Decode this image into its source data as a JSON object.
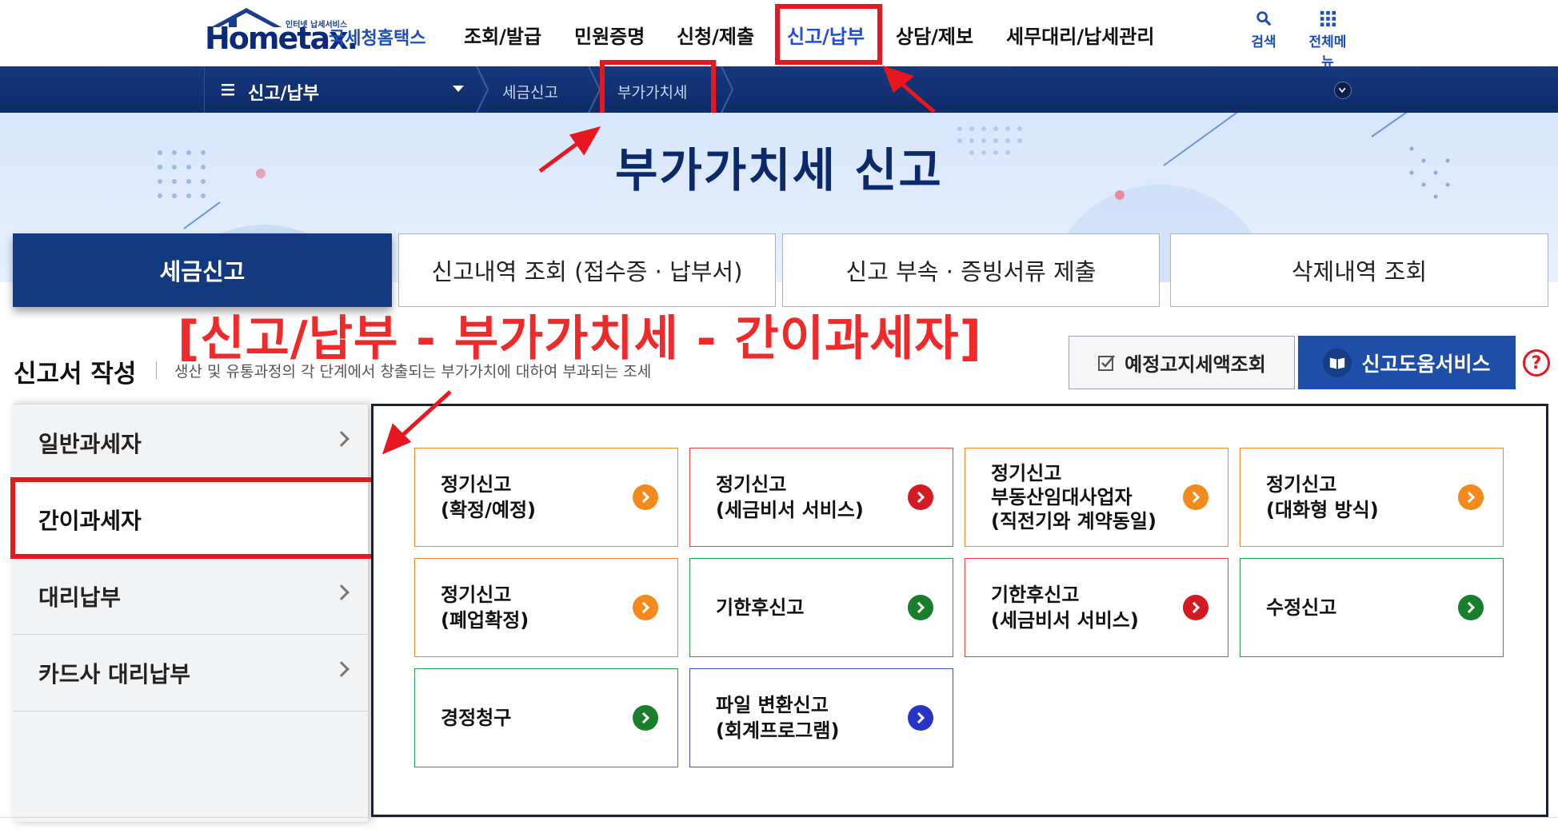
{
  "header": {
    "logo_sub": "인터넷 납세서비스",
    "logo_main": "Hometax.",
    "logo_kr": "국세청홈택스",
    "nav": [
      "조회/발급",
      "민원증명",
      "신청/제출",
      "신고/납부",
      "상담/제보",
      "세무대리/납세관리"
    ],
    "active_nav": "신고/납부",
    "search_label": "검색",
    "allmenu_label": "전체메뉴"
  },
  "locbar": {
    "menu_label": "신고/납부",
    "crumb1": "세금신고",
    "crumb2": "부가가치세"
  },
  "banner": {
    "title": "부가가치세  신고"
  },
  "tabs": [
    "세금신고",
    "신고내역 조회 (접수증 · 납부서)",
    "신고 부속 · 증빙서류 제출",
    "삭제내역 조회"
  ],
  "annotation": "[신고/납부 - 부가가치세 - 간이과세자]",
  "section": {
    "title": "신고서 작성",
    "desc": "생산 및 유통과정의 각 단계에서 창출되는 부가가치에 대하여 부과되는 조세",
    "btn_estimate": "예정고지세액조회",
    "btn_help": "신고도움서비스",
    "help_icon": "?"
  },
  "sidebar": {
    "items": [
      {
        "label": "일반과세자"
      },
      {
        "label": "간이과세자"
      },
      {
        "label": "대리납부"
      },
      {
        "label": "카드사 대리납부"
      }
    ]
  },
  "cards": [
    {
      "l1": "정기신고",
      "l2": "(확정/예정)",
      "l3": "",
      "color": "orange"
    },
    {
      "l1": "정기신고",
      "l2": "(세금비서 서비스)",
      "l3": "",
      "color": "red"
    },
    {
      "l1": "정기신고",
      "l2": "부동산임대사업자",
      "l3": "(직전기와 계약동일)",
      "color": "orange"
    },
    {
      "l1": "정기신고",
      "l2": "(대화형 방식)",
      "l3": "",
      "color": "orange"
    },
    {
      "l1": "정기신고",
      "l2": "(폐업확정)",
      "l3": "",
      "color": "orange"
    },
    {
      "l1": "기한후신고",
      "l2": "",
      "l3": "",
      "color": "green"
    },
    {
      "l1": "기한후신고",
      "l2": "(세금비서 서비스)",
      "l3": "",
      "color": "red"
    },
    {
      "l1": "수정신고",
      "l2": "",
      "l3": "",
      "color": "green"
    },
    {
      "l1": "경정청구",
      "l2": "",
      "l3": "",
      "color": "green"
    },
    {
      "l1": "파일 변환신고",
      "l2": "(회계프로그램)",
      "l3": "",
      "color": "blue"
    }
  ],
  "colors": {
    "navy": "#13397f",
    "accent_blue": "#1d4fd8",
    "highlight_red": "#e8161f",
    "annotation_red": "#ee2a2a",
    "orange": "#f28a1e",
    "green": "#1a7f2c",
    "red": "#d41b24",
    "blue": "#2a33c8"
  }
}
